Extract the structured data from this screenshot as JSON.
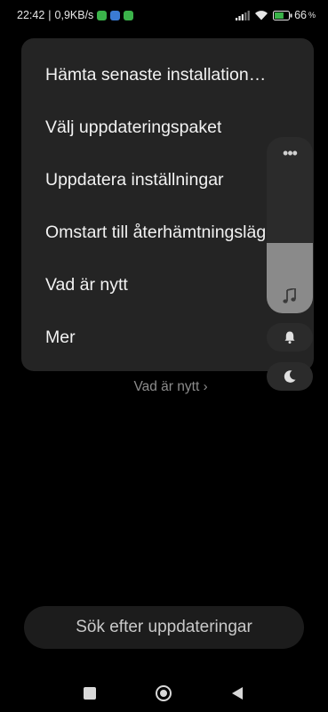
{
  "status_bar": {
    "time": "22:42",
    "speed": "0,9KB/s",
    "battery_percent": "66",
    "battery_level": 0.66,
    "notif_colors": [
      "#3bb34a",
      "#3b7bd4",
      "#3bb34a"
    ]
  },
  "menu": {
    "items": [
      {
        "label": "Hämta senaste installation…"
      },
      {
        "label": "Välj uppdateringspaket"
      },
      {
        "label": "Uppdatera inställningar"
      },
      {
        "label": "Omstart till återhämtningsläge"
      },
      {
        "label": "Vad är nytt"
      },
      {
        "label": "Mer"
      }
    ]
  },
  "whats_new_link": "Vad är nytt",
  "volume_panel": {
    "level": 0.4,
    "more_icon": "more-dots-icon",
    "media_icon": "music-note-icon",
    "ring_icon": "bell-icon",
    "dnd_icon": "moon-icon"
  },
  "check_button": {
    "label": "Sök efter uppdateringar"
  },
  "nav": {
    "back": "back-triangle-icon",
    "home": "home-circle-icon",
    "recents": "recents-square-icon"
  },
  "colors": {
    "background": "#000000",
    "menu_bg": "#242424",
    "accent_gray": "#8a8a8a"
  }
}
